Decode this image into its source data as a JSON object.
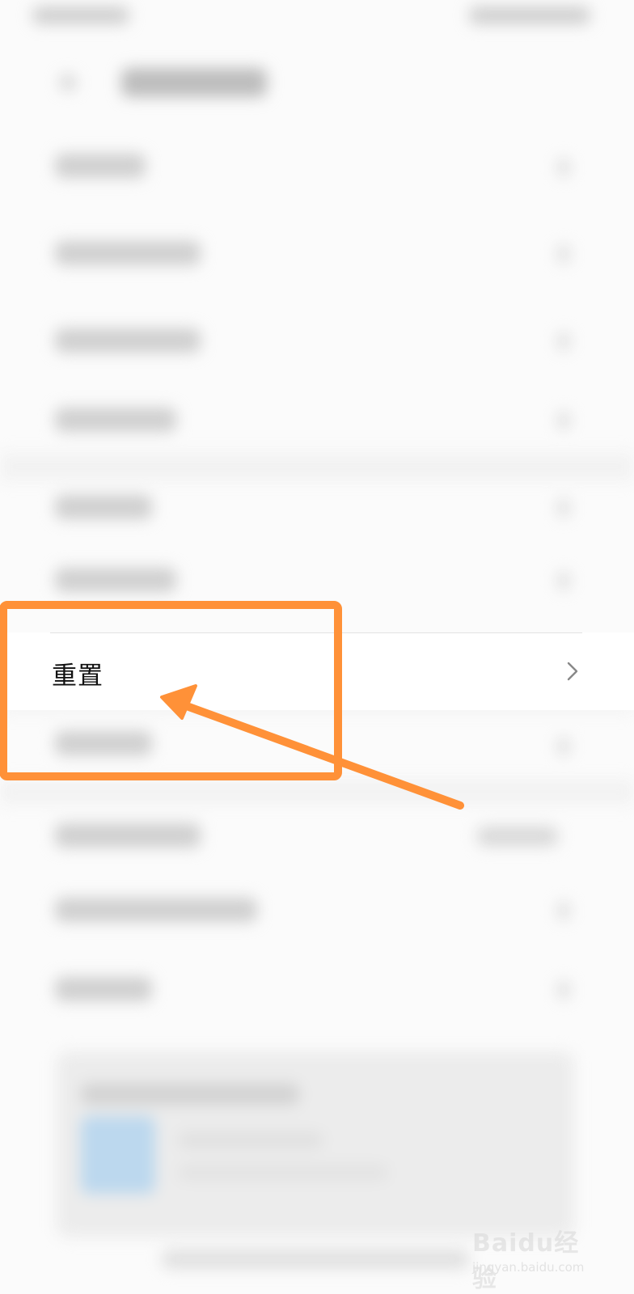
{
  "settings": {
    "reset_label": "重置"
  },
  "icons": {
    "reset_chevron": "chevron-right-icon"
  },
  "colors": {
    "annotation_orange": "#ff9138",
    "chevron_gray": "#888888",
    "text_primary": "#111111"
  },
  "watermark": {
    "brand": "Baidu经验",
    "url": "jingyan.baidu.com"
  }
}
